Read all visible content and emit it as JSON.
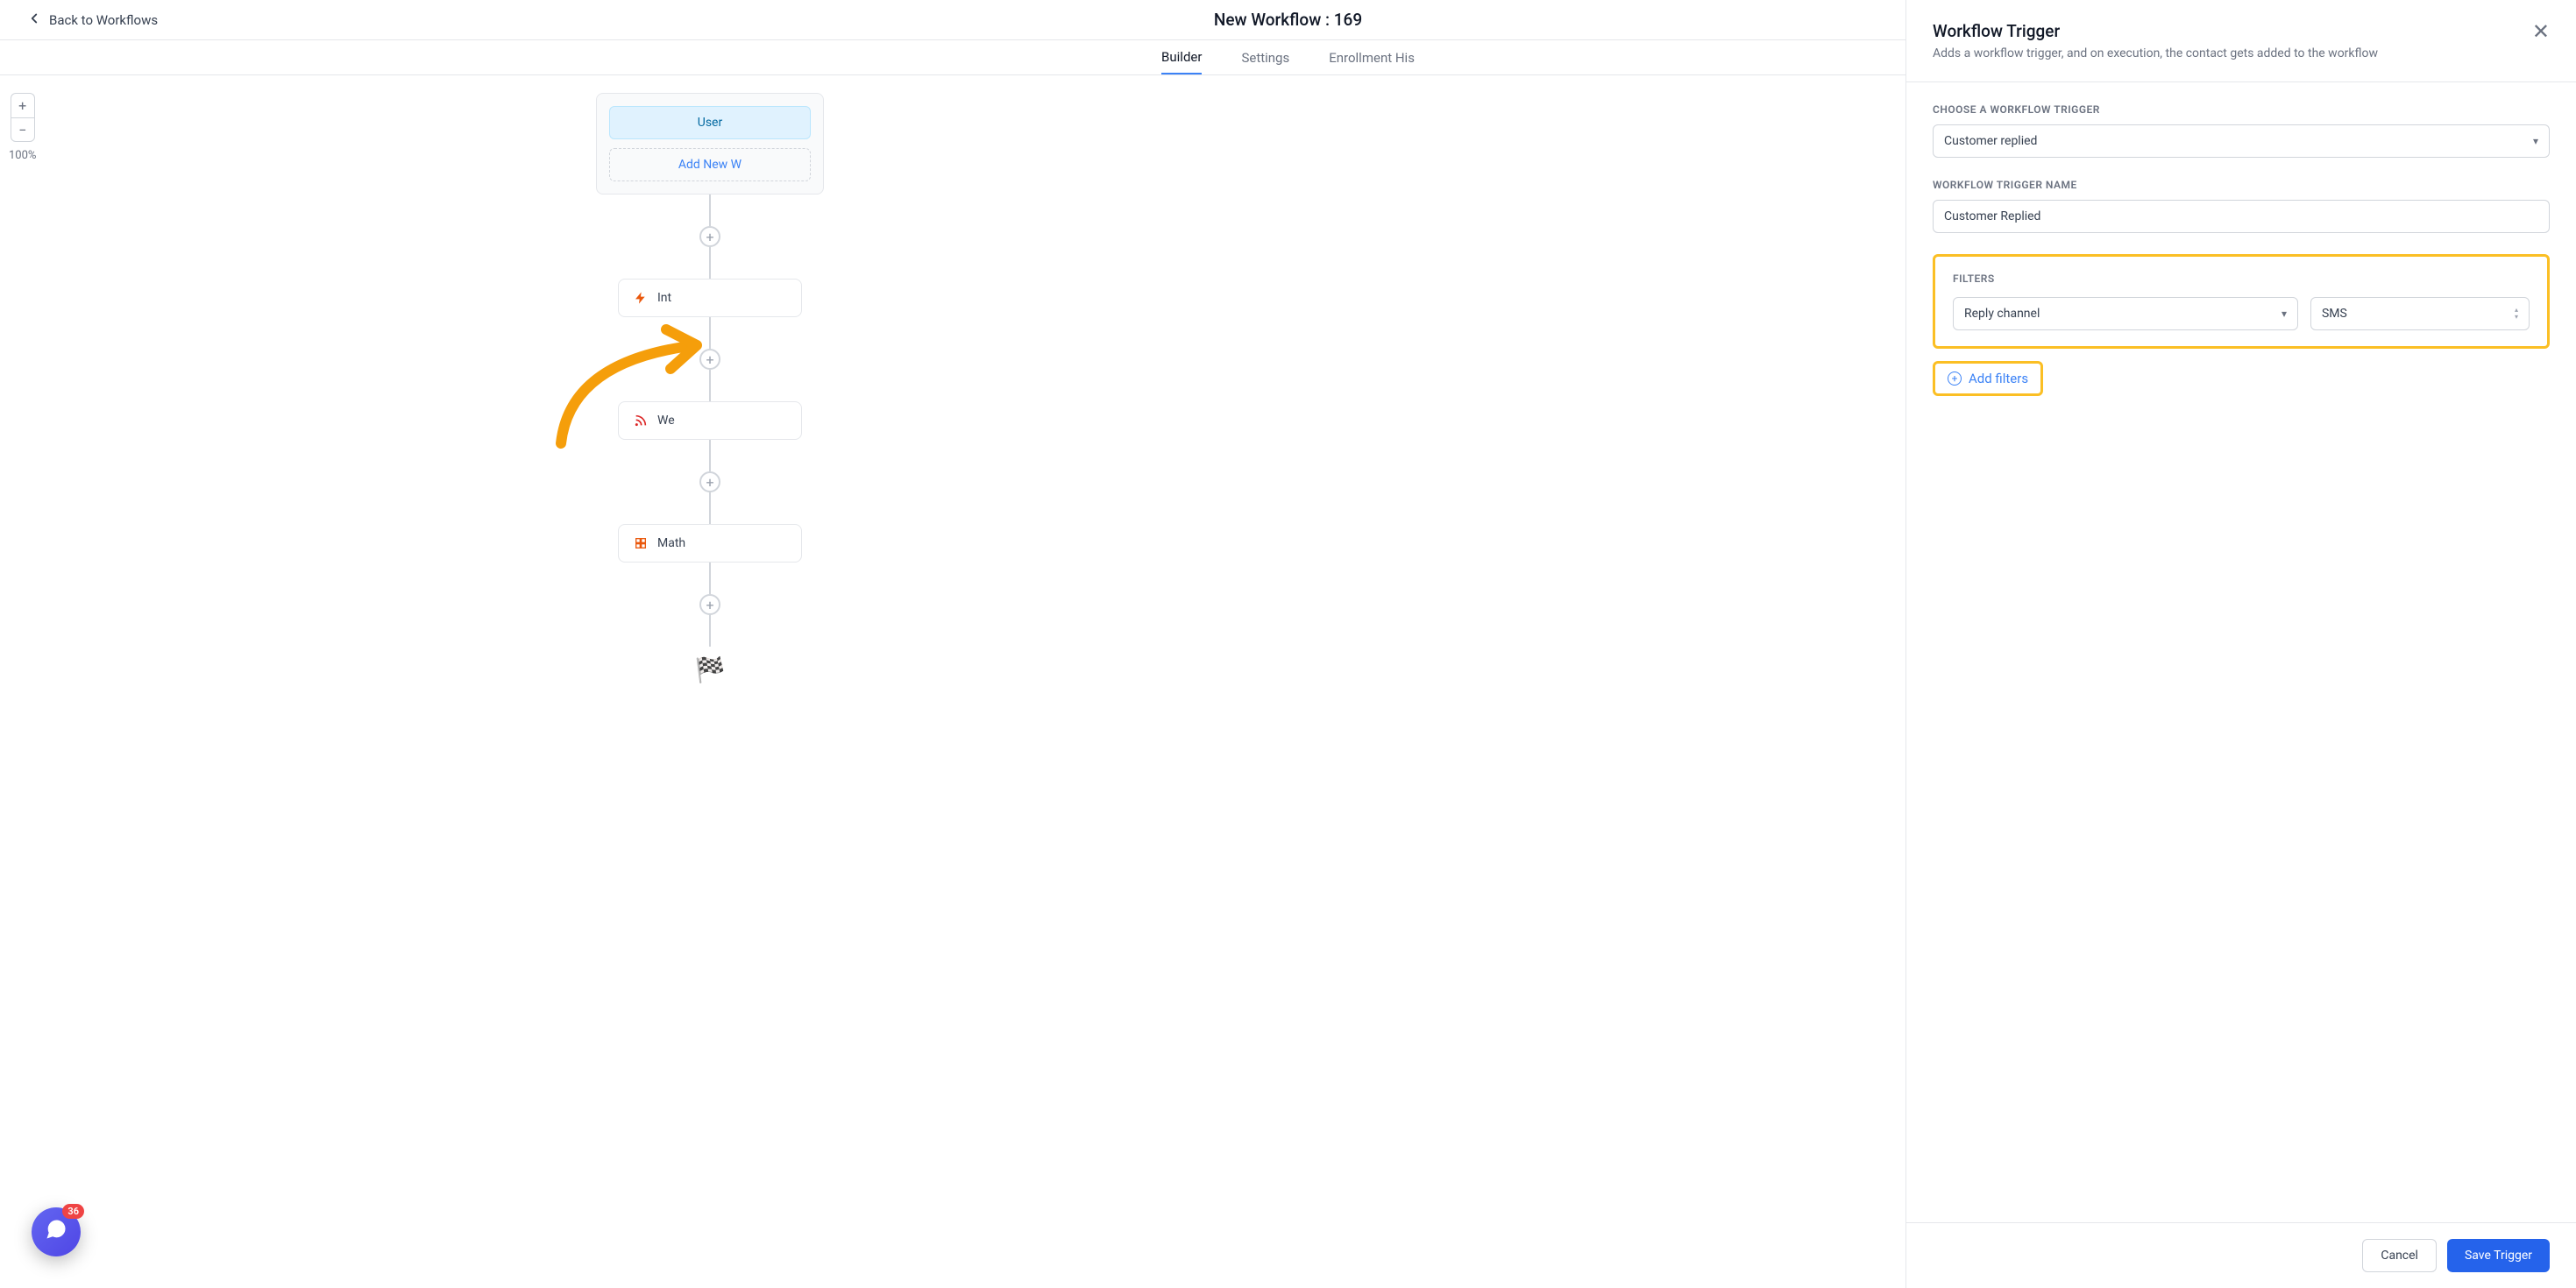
{
  "header": {
    "back_label": "Back to Workflows",
    "title_partial": "New Workflow : 169"
  },
  "tabs": {
    "builder": "Builder",
    "settings": "Settings",
    "enrollment_partial": "Enrollment His"
  },
  "zoom": {
    "plus": "+",
    "minus": "−",
    "percent": "100%"
  },
  "canvas": {
    "trigger_pill": "User",
    "add_trigger": "Add New W",
    "node_internal_partial": "Int",
    "node_we": "We",
    "node_math": "Math"
  },
  "panel": {
    "title": "Workflow Trigger",
    "subtitle": "Adds a workflow trigger, and on execution, the contact gets added to the workflow",
    "trigger_choose_label": "CHOOSE A WORKFLOW TRIGGER",
    "trigger_choose_value": "Customer replied",
    "trigger_name_label": "WORKFLOW TRIGGER NAME",
    "trigger_name_value": "Customer Replied",
    "filters_label": "FILTERS",
    "filter_field": "Reply channel",
    "filter_value": "SMS",
    "add_filters": "Add filters",
    "footer": {
      "cancel": "Cancel",
      "save": "Save Trigger"
    }
  },
  "chat": {
    "badge": "36"
  }
}
